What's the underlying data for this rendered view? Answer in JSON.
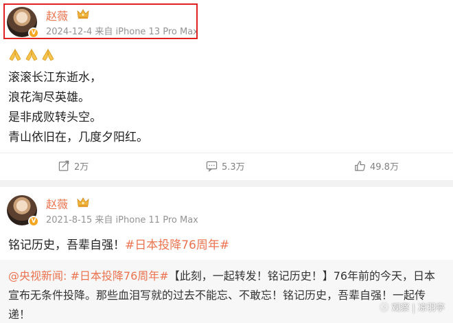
{
  "post1": {
    "author": "赵薇",
    "verified_badge": "V",
    "meta": "2024-12-4 来自 iPhone 13 Pro Max",
    "emoji": [
      "pray-emoji",
      "pray-emoji",
      "pray-emoji"
    ],
    "lines": [
      "滚滚长江东逝水，",
      "浪花淘尽英雄。",
      "是非成败转头空。",
      "青山依旧在，几度夕阳红。"
    ],
    "actions": {
      "repost": "2万",
      "comment": "5.3万",
      "like": "49.8万"
    }
  },
  "post2": {
    "author": "赵薇",
    "verified_badge": "V",
    "meta": "2021-8-15 来自 iPhone 11 Pro Max",
    "text_plain": "铭记历史，吾辈自强！",
    "text_tag": "#日本投降76周年#",
    "repost": {
      "source": "@央视新闻:",
      "tag": "#日本投降76周年#",
      "line1_rest": "【此刻，一起转发！铭记历史！】76年前的今天，日本",
      "line2": "宣布无条件投降。那些血泪写就的过去不能忘、不敢忘！铭记历史，吾辈自强！一起传",
      "line3": "递！"
    }
  },
  "watermark": "ⓩ 观察 | 凉羽亭",
  "colors": {
    "accent": "#eb7350",
    "meta": "#939393",
    "highlight": "#e02020",
    "badge": "#f5a623"
  }
}
